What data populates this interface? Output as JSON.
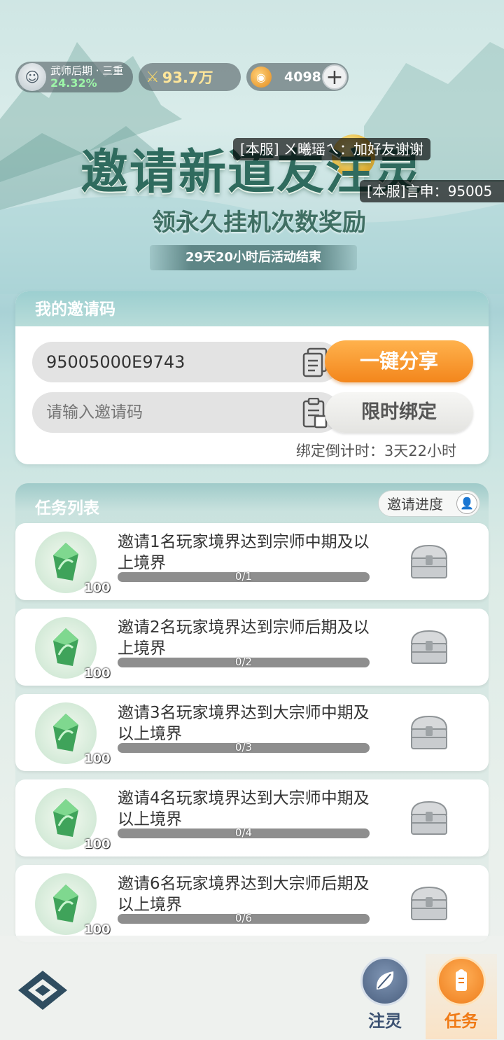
{
  "status": {
    "rank_name": "武师后期 · 三重",
    "rank_progress": "24.32%",
    "combat_power": "93.7万",
    "currency": "4098",
    "icons": {
      "rank": "warrior-avatar-icon",
      "power": "crossed-swords-icon",
      "currency": "spirit-coin-icon",
      "add": "plus-icon"
    }
  },
  "banner": {
    "title": "邀请新道友注灵",
    "subtitle": "领永久挂机次数奖励",
    "countdown": "29天20小时后活动结束"
  },
  "chat_bullets": [
    {
      "text": "[本服] ㄨ曦瑶ㄟ：加好友谢谢"
    },
    {
      "text": "[本服]言申：95005"
    }
  ],
  "invite": {
    "header": "我的邀请码",
    "my_code": "95005000E9743",
    "share_label": "一键分享",
    "input_placeholder": "请输入邀请码",
    "bind_label": "限时绑定",
    "bind_timer": "绑定倒计时：3天22小时"
  },
  "tasks": {
    "header": "任务列表",
    "progress_button": "邀请进度",
    "items": [
      {
        "desc": "邀请1名玩家境界达到宗师中期及以上境界",
        "reward": "100",
        "progress": "0/1",
        "ratio": 0
      },
      {
        "desc": "邀请2名玩家境界达到宗师后期及以上境界",
        "reward": "100",
        "progress": "0/2",
        "ratio": 0
      },
      {
        "desc": "邀请3名玩家境界达到大宗师中期及以上境界",
        "reward": "100",
        "progress": "0/3",
        "ratio": 0
      },
      {
        "desc": "邀请4名玩家境界达到大宗师中期及以上境界",
        "reward": "100",
        "progress": "0/4",
        "ratio": 0
      },
      {
        "desc": "邀请6名玩家境界达到大宗师后期及以上境界",
        "reward": "100",
        "progress": "0/6",
        "ratio": 0
      }
    ]
  },
  "nav": {
    "spirit_label": "注灵",
    "task_label": "任务",
    "active": "任务"
  },
  "colors": {
    "accent_orange": "#f3861c",
    "progress_green": "#4fb06a",
    "title_green": "#2f6b5e"
  }
}
